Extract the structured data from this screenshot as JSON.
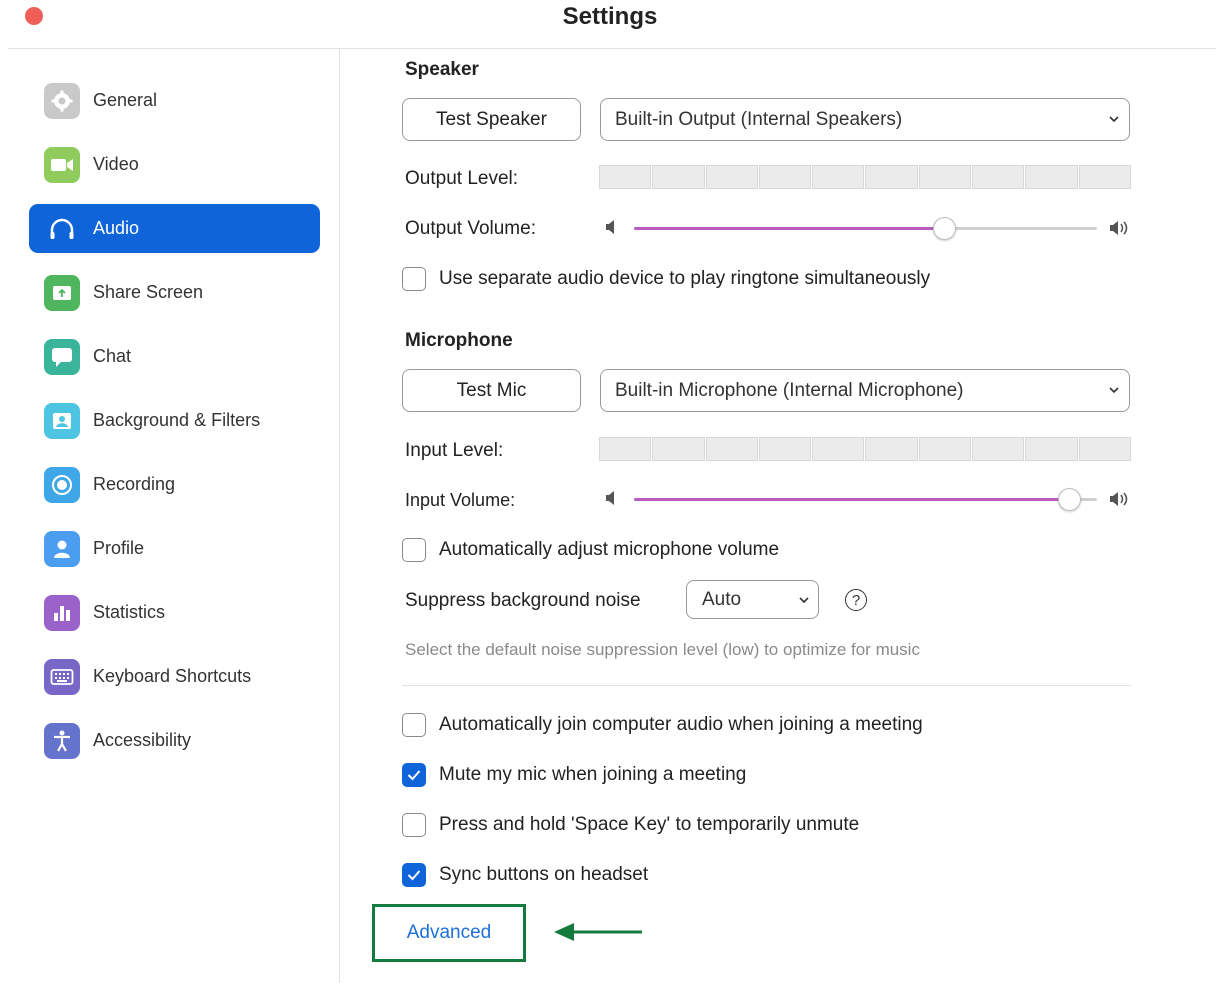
{
  "window": {
    "title": "Settings"
  },
  "sidebar": {
    "items": [
      {
        "label": "General",
        "icon": "gear-icon",
        "color": "#c9c9c9",
        "active": false
      },
      {
        "label": "Video",
        "icon": "video-camera-icon",
        "color": "#8fcc5d",
        "active": false
      },
      {
        "label": "Audio",
        "icon": "headphones-icon",
        "color": "#ffffff",
        "active": true
      },
      {
        "label": "Share Screen",
        "icon": "share-screen-icon",
        "color": "#4fb55e",
        "active": false
      },
      {
        "label": "Chat",
        "icon": "chat-bubble-icon",
        "color": "#3ab59c",
        "active": false
      },
      {
        "label": "Background & Filters",
        "icon": "background-icon",
        "color": "#4ec4e3",
        "active": false
      },
      {
        "label": "Recording",
        "icon": "record-icon",
        "color": "#3fa6e8",
        "active": false
      },
      {
        "label": "Profile",
        "icon": "person-icon",
        "color": "#4b9df0",
        "active": false
      },
      {
        "label": "Statistics",
        "icon": "bar-chart-icon",
        "color": "#9b63c9",
        "active": false
      },
      {
        "label": "Keyboard Shortcuts",
        "icon": "keyboard-icon",
        "color": "#7867c6",
        "active": false
      },
      {
        "label": "Accessibility",
        "icon": "accessibility-icon",
        "color": "#6673cc",
        "active": false
      }
    ]
  },
  "speaker": {
    "title": "Speaker",
    "test_button": "Test Speaker",
    "device": "Built-in Output (Internal Speakers)",
    "output_level_label": "Output Level:",
    "output_volume_label": "Output Volume:",
    "output_volume": 0.67,
    "ringtone_checkbox": {
      "label": "Use separate audio device to play ringtone simultaneously",
      "checked": false
    }
  },
  "microphone": {
    "title": "Microphone",
    "test_button": "Test Mic",
    "device": "Built-in Microphone (Internal Microphone)",
    "input_level_label": "Input Level:",
    "input_volume_label": "Input Volume:",
    "input_volume": 0.94,
    "auto_adjust": {
      "label": "Automatically adjust microphone volume",
      "checked": false
    },
    "suppress_label": "Suppress background noise",
    "suppress_value": "Auto",
    "hint": "Select the default noise suppression level (low) to optimize for music"
  },
  "options": [
    {
      "label": "Automatically join computer audio when joining a meeting",
      "checked": false
    },
    {
      "label": "Mute my mic when joining a meeting",
      "checked": true
    },
    {
      "label": "Press and hold 'Space Key' to temporarily unmute",
      "checked": false
    },
    {
      "label": "Sync buttons on headset",
      "checked": true
    }
  ],
  "advanced_label": "Advanced",
  "colors": {
    "accent": "#0e64d8",
    "slider": "#b95cbf",
    "highlight_box": "#137b3d"
  }
}
